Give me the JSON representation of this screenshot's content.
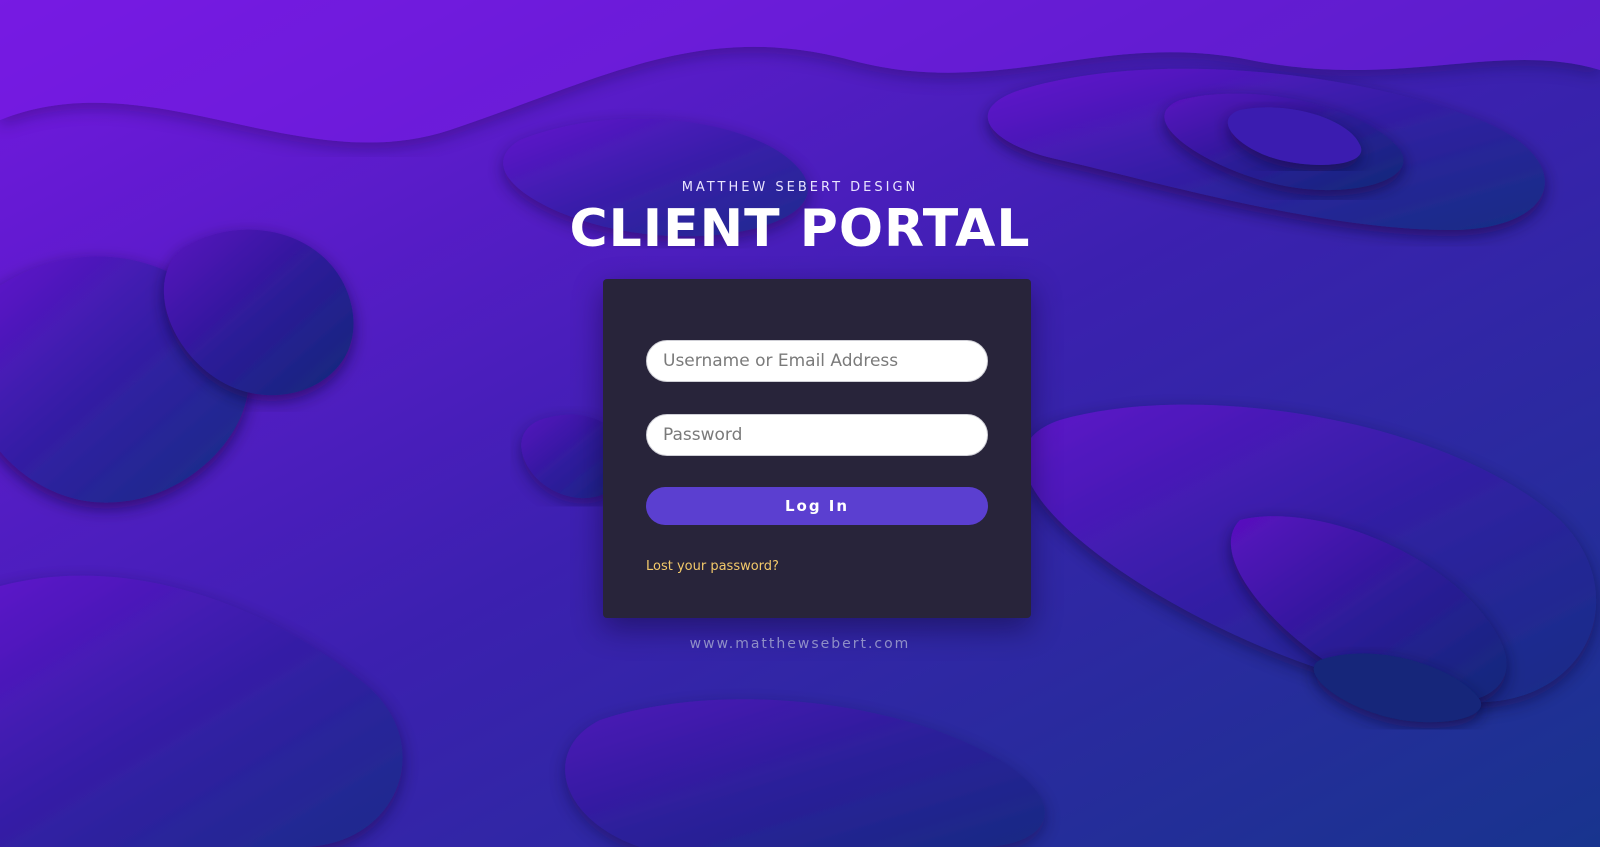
{
  "header": {
    "brand": "MATTHEW SEBERT DESIGN",
    "title": "CLIENT PORTAL"
  },
  "login_form": {
    "username_placeholder": "Username or Email Address",
    "username_value": "",
    "password_placeholder": "Password",
    "password_value": "",
    "submit_label": "Log In",
    "lost_password_label": "Lost your password?"
  },
  "footer": {
    "url": "www.matthewsebert.com"
  },
  "colors": {
    "card_background": "#28243a",
    "button": "#5b3fd0",
    "link": "#f3c96a",
    "background_start": "#6a12d8",
    "background_end": "#1d3592"
  }
}
